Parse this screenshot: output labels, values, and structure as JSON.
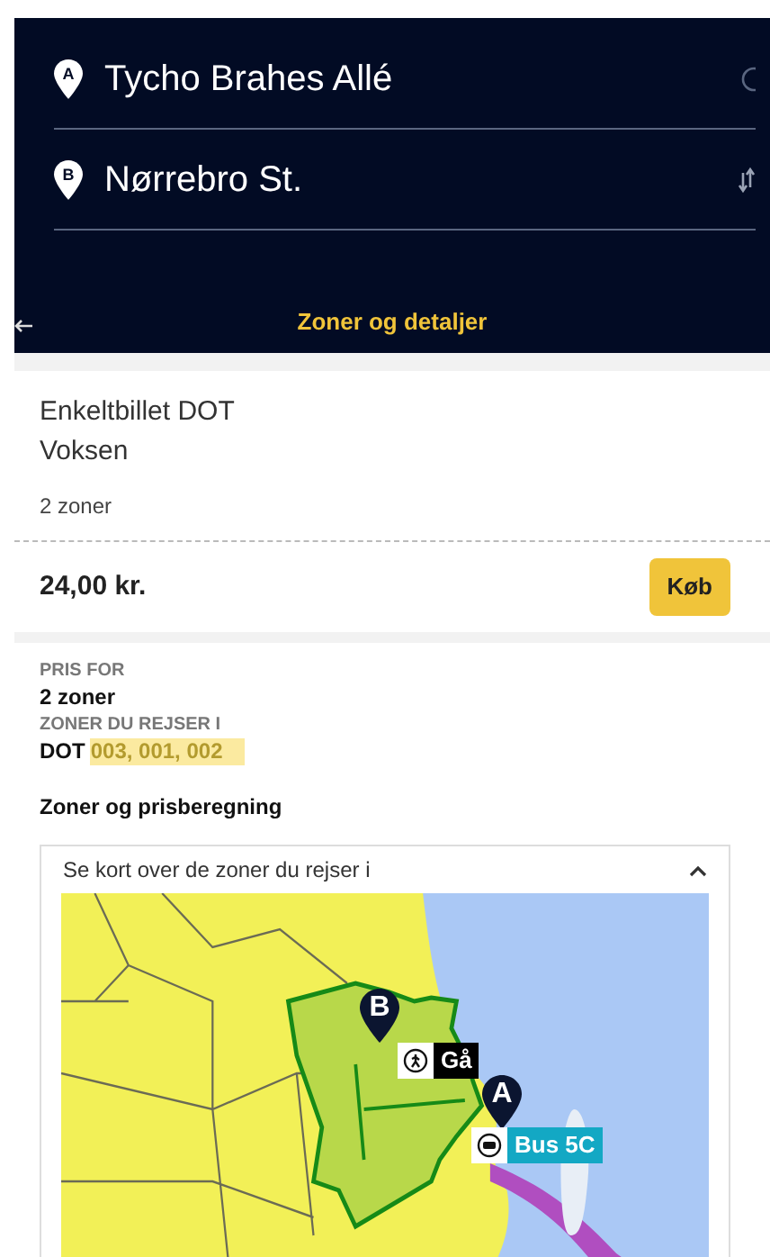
{
  "route": {
    "from": {
      "pin": "A",
      "value": "Tycho Brahes Allé"
    },
    "to": {
      "pin": "B",
      "value": "Nørrebro St."
    }
  },
  "nav": {
    "title": "Zoner og detaljer"
  },
  "ticket": {
    "name": "Enkeltbillet DOT",
    "traveller": "Voksen",
    "zones": "2 zoner",
    "price": "24,00 kr.",
    "buy_button": "Køb"
  },
  "details": {
    "price_for_label": "PRIS FOR",
    "price_for_value": "2 zoner",
    "zones_label": "ZONER DU REJSER I",
    "zones_prefix": "DOT",
    "zones_value": "003, 001, 002"
  },
  "section_title": "Zoner og prisberegning",
  "map_panel": {
    "title": "Se kort over de zoner du rejser i",
    "expanded": true,
    "markers": [
      {
        "pin": "B"
      },
      {
        "pin": "A"
      }
    ],
    "legs": [
      {
        "kind": "walk",
        "label": "Gå"
      },
      {
        "kind": "bus",
        "label": "Bus 5C"
      }
    ]
  }
}
